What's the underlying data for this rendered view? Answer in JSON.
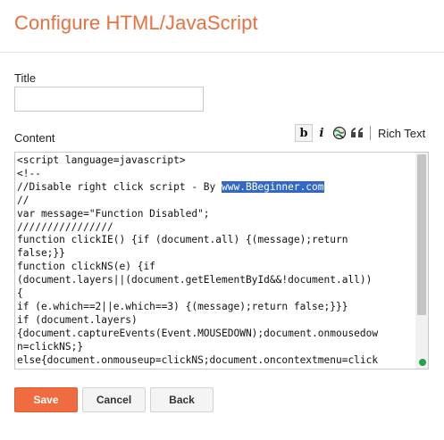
{
  "header": {
    "title": "Configure HTML/JavaScript"
  },
  "form": {
    "title_label": "Title",
    "title_value": "",
    "content_label": "Content"
  },
  "toolbar": {
    "bold": "b",
    "italic": "i",
    "rich_text": "Rich Text"
  },
  "editor": {
    "before_highlight": "<script language=javascript>\n<!--\n//Disable right click script - By ",
    "highlighted": "www.BBeginner.com",
    "after_highlight": "\n//\nvar message=\"Function Disabled\";\n////////////////\nfunction clickIE() {if (document.all) {(message);return\nfalse;}}\nfunction clickNS(e) {if\n(document.layers||(document.getElementById&&!document.all))\n{\nif (e.which==2||e.which==3) {(message);return false;}}}\nif (document.layers)\n{document.captureEvents(Event.MOUSEDOWN);document.onmousedow\nn=clickNS;}\nelse{document.onmouseup=clickNS;document.oncontextmenu=click"
  },
  "buttons": {
    "save": "Save",
    "cancel": "Cancel",
    "back": "Back"
  },
  "colors": {
    "accent": "#e8703f",
    "save_bg": "#f06b3f",
    "selection": "#3368c4"
  }
}
